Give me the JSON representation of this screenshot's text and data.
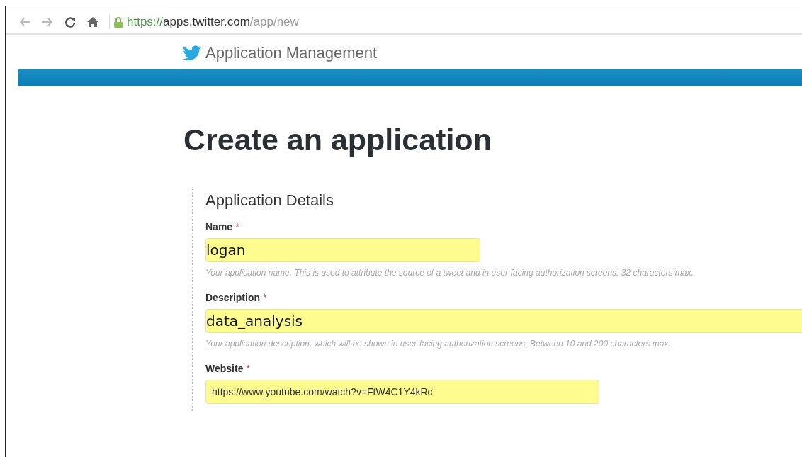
{
  "browser": {
    "url": {
      "scheme": "https://",
      "host": "apps.twitter.com",
      "path": "/app/new"
    }
  },
  "header": {
    "title": "Application Management"
  },
  "page": {
    "title": "Create an application"
  },
  "form": {
    "title": "Application Details",
    "fields": [
      {
        "label": "Name",
        "required_mark": "*",
        "value": "logan",
        "hint": "Your application name. This is used to attribute the source of a tweet and in user-facing authorization screens. 32 characters max."
      },
      {
        "label": "Description",
        "required_mark": "*",
        "value": "data_analysis",
        "hint": "Your application description, which will be shown in user-facing authorization screens. Between 10 and 200 characters max."
      },
      {
        "label": "Website",
        "required_mark": "*",
        "value": "https://www.youtube.com/watch?v=FtW4C1Y4kRc"
      }
    ]
  }
}
